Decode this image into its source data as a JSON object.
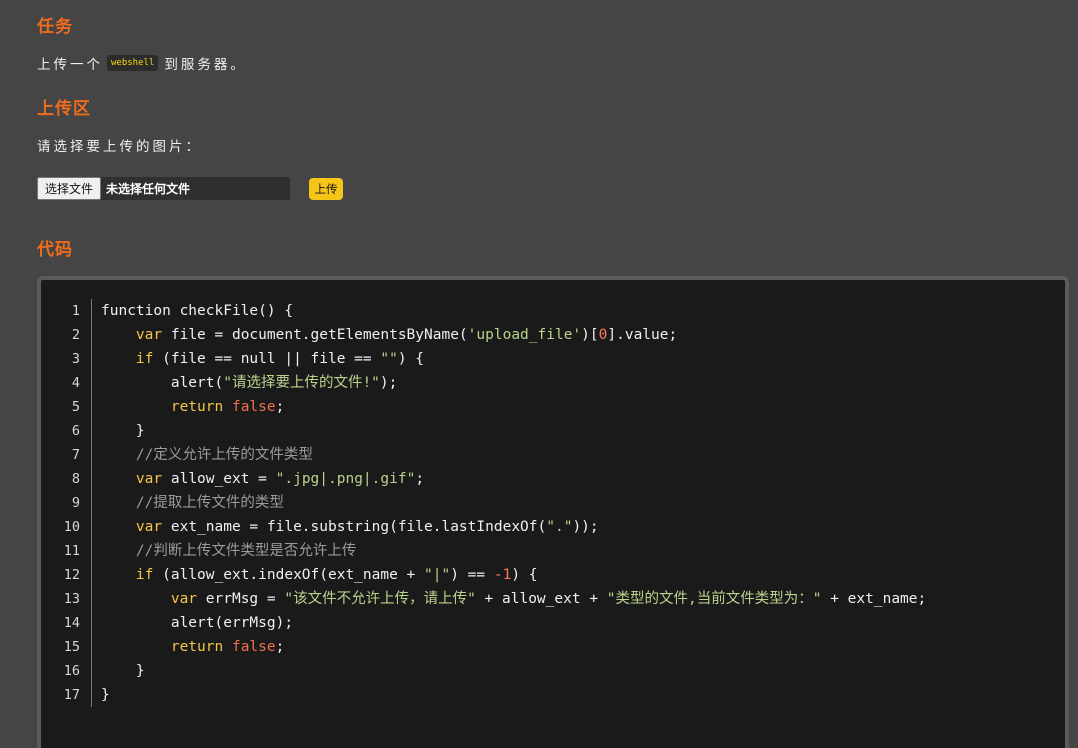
{
  "sections": {
    "task_heading": "任务",
    "task_text_before": "上传一个",
    "task_code": "webshell",
    "task_text_after": "到服务器。",
    "upload_heading": "上传区",
    "upload_prompt": "请选择要上传的图片：",
    "file_button_label": "选择文件",
    "file_status": "未选择任何文件",
    "upload_button_label": "上传",
    "code_heading": "代码"
  },
  "code": {
    "line_numbers": [
      "1",
      "2",
      "3",
      "4",
      "5",
      "6",
      "7",
      "8",
      "9",
      "10",
      "11",
      "12",
      "13",
      "14",
      "15",
      "16",
      "17"
    ],
    "lines": [
      "function checkFile() {",
      "    var file = document.getElementsByName('upload_file')[0].value;",
      "    if (file == null || file == \"\") {",
      "        alert(\"请选择要上传的文件!\");",
      "        return false;",
      "    }",
      "    //定义允许上传的文件类型",
      "    var allow_ext = \".jpg|.png|.gif\";",
      "    //提取上传文件的类型",
      "    var ext_name = file.substring(file.lastIndexOf(\".\"));",
      "    //判断上传文件类型是否允许上传",
      "    if (allow_ext.indexOf(ext_name + \"|\") == -1) {",
      "        var errMsg = \"该文件不允许上传，请上传\" + allow_ext + \"类型的文件,当前文件类型为：\" + ext_name;",
      "        alert(errMsg);",
      "        return false;",
      "    }",
      "}"
    ]
  },
  "colors": {
    "heading": "#ef6c1c",
    "background": "#454545",
    "code_background": "#1a1a1b",
    "upload_button": "#f5c518"
  }
}
